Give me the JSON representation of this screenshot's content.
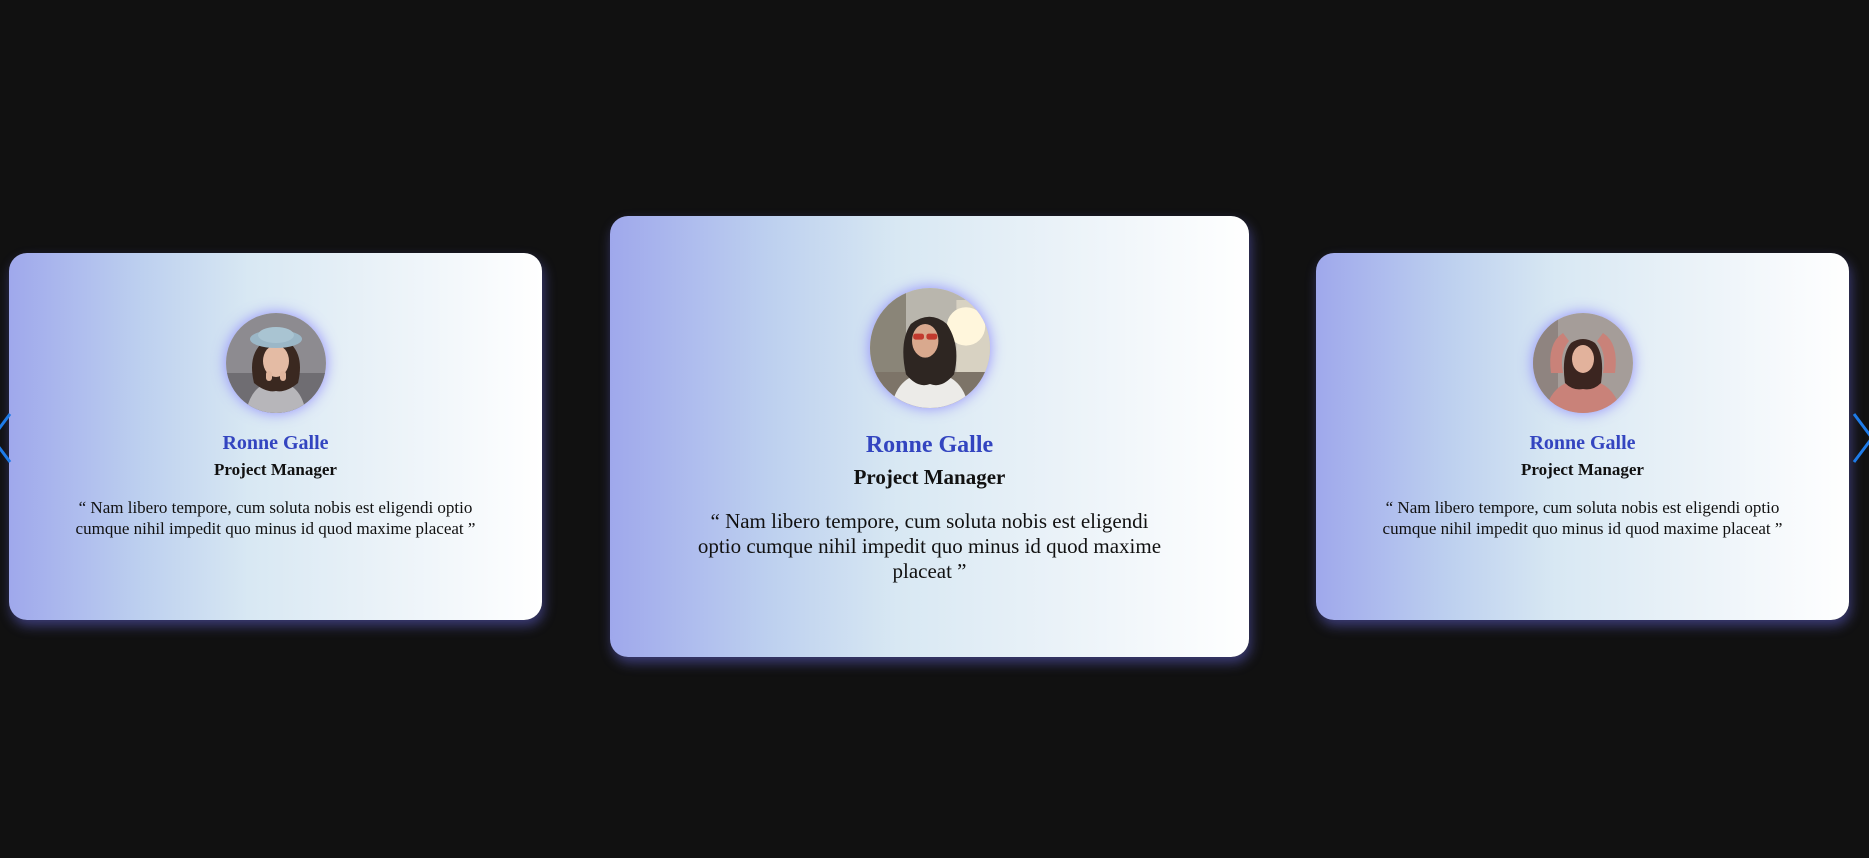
{
  "carousel": {
    "cards": [
      {
        "avatar_icon": "woman-beret-portrait",
        "name": "Ronne Galle",
        "role": "Project Manager",
        "quote": "“ Nam libero tempore, cum soluta nobis est eligendi optio cumque nihil impedit quo minus id quod maxime placeat ”"
      },
      {
        "avatar_icon": "woman-sunglasses-portrait",
        "name": "Ronne Galle",
        "role": "Project Manager",
        "quote": "“ Nam libero tempore, cum soluta nobis est eligendi optio cumque nihil impedit quo minus id quod maxime placeat ”"
      },
      {
        "avatar_icon": "woman-pink-sweater-portrait",
        "name": "Ronne Galle",
        "role": "Project Manager",
        "quote": "“ Nam libero tempore, cum soluta nobis est eligendi optio cumque nihil impedit quo minus id quod maxime placeat ”"
      }
    ],
    "nav": {
      "prev_icon": "chevron-left-icon",
      "next_icon": "chevron-right-icon"
    }
  },
  "colors": {
    "background": "#111111",
    "name_accent": "#3345c0",
    "nav_accent": "#1e7be8",
    "gradient_start": "#9fa8ec",
    "gradient_end": "#ffffff"
  }
}
